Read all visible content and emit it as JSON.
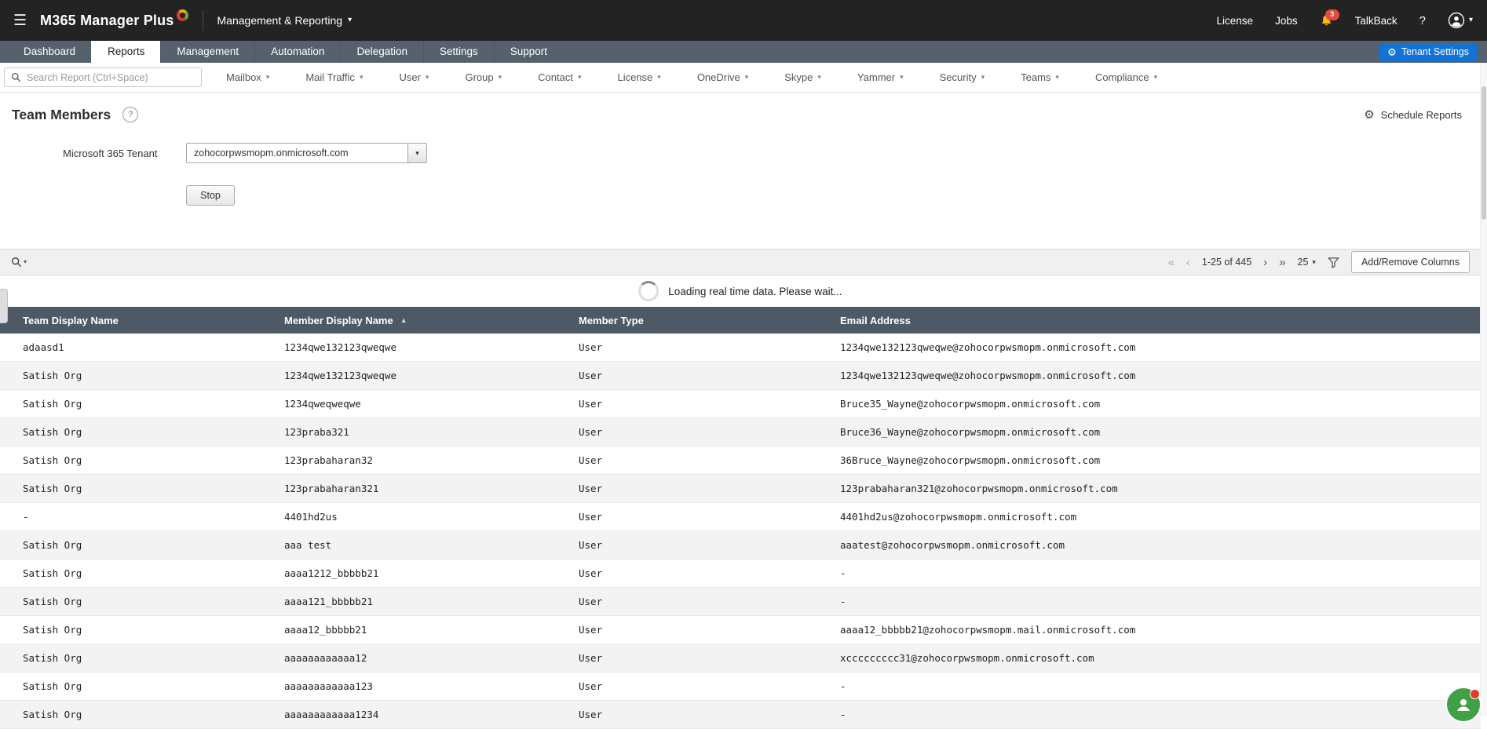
{
  "icons": {
    "hamburger": "☰",
    "caret_down": "▾",
    "sort_asc": "▲",
    "first_page": "«",
    "prev_page": "‹",
    "next_page": "›",
    "last_page": "»",
    "gear": "⚙",
    "help": "?"
  },
  "topbar": {
    "app_name": "M365 Manager Plus",
    "context_switcher": "Management & Reporting",
    "license_link": "License",
    "jobs_link": "Jobs",
    "notification_count": "3",
    "talkback_link": "TalkBack"
  },
  "nav": {
    "tabs": [
      {
        "label": "Dashboard"
      },
      {
        "label": "Reports",
        "active": true
      },
      {
        "label": "Management"
      },
      {
        "label": "Automation"
      },
      {
        "label": "Delegation"
      },
      {
        "label": "Settings"
      },
      {
        "label": "Support"
      }
    ],
    "tenant_settings_label": "Tenant Settings"
  },
  "reportnav": {
    "search_placeholder": "Search Report (Ctrl+Space)",
    "menus": [
      {
        "label": "Mailbox"
      },
      {
        "label": "Mail Traffic"
      },
      {
        "label": "User"
      },
      {
        "label": "Group"
      },
      {
        "label": "Contact"
      },
      {
        "label": "License"
      },
      {
        "label": "OneDrive"
      },
      {
        "label": "Skype"
      },
      {
        "label": "Yammer"
      },
      {
        "label": "Security"
      },
      {
        "label": "Teams"
      },
      {
        "label": "Compliance"
      }
    ]
  },
  "page": {
    "title": "Team Members",
    "schedule_reports_label": "Schedule Reports",
    "tenant_field_label": "Microsoft 365 Tenant",
    "tenant_selected_value": "zohocorpwsmopm.onmicrosoft.com",
    "stop_button_label": "Stop"
  },
  "grid_toolbar": {
    "pagination_text": "1-25 of 445",
    "page_size": "25",
    "add_remove_columns_label": "Add/Remove Columns"
  },
  "loading_message": "Loading real time data. Please wait...",
  "table": {
    "columns": [
      {
        "label": "Team Display Name"
      },
      {
        "label": "Member Display Name",
        "sort_icon": "▲"
      },
      {
        "label": "Member Type"
      },
      {
        "label": "Email Address"
      }
    ],
    "rows": [
      {
        "team": "adaasd1",
        "member": "1234qwe132123qweqwe",
        "type": "User",
        "email": "1234qwe132123qweqwe@zohocorpwsmopm.onmicrosoft.com"
      },
      {
        "team": "Satish Org",
        "member": "1234qwe132123qweqwe",
        "type": "User",
        "email": "1234qwe132123qweqwe@zohocorpwsmopm.onmicrosoft.com"
      },
      {
        "team": "Satish Org",
        "member": "1234qweqweqwe",
        "type": "User",
        "email": "Bruce35_Wayne@zohocorpwsmopm.onmicrosoft.com"
      },
      {
        "team": "Satish Org",
        "member": "123praba321",
        "type": "User",
        "email": "Bruce36_Wayne@zohocorpwsmopm.onmicrosoft.com"
      },
      {
        "team": "Satish Org",
        "member": "123prabaharan32",
        "type": "User",
        "email": "36Bruce_Wayne@zohocorpwsmopm.onmicrosoft.com"
      },
      {
        "team": "Satish Org",
        "member": "123prabaharan321",
        "type": "User",
        "email": "123prabaharan321@zohocorpwsmopm.onmicrosoft.com"
      },
      {
        "team": "-",
        "member": "4401hd2us",
        "type": "User",
        "email": "4401hd2us@zohocorpwsmopm.onmicrosoft.com"
      },
      {
        "team": "Satish Org",
        "member": "aaa test",
        "type": "User",
        "email": "aaatest@zohocorpwsmopm.onmicrosoft.com"
      },
      {
        "team": "Satish Org",
        "member": "aaaa1212_bbbbb21",
        "type": "User",
        "email": "-"
      },
      {
        "team": "Satish Org",
        "member": "aaaa121_bbbbb21",
        "type": "User",
        "email": "-"
      },
      {
        "team": "Satish Org",
        "member": "aaaa12_bbbbb21",
        "type": "User",
        "email": "aaaa12_bbbbb21@zohocorpwsmopm.mail.onmicrosoft.com"
      },
      {
        "team": "Satish Org",
        "member": "aaaaaaaaaaaa12",
        "type": "User",
        "email": "xccccccccc31@zohocorpwsmopm.onmicrosoft.com"
      },
      {
        "team": "Satish Org",
        "member": "aaaaaaaaaaaa123",
        "type": "User",
        "email": "-"
      },
      {
        "team": "Satish Org",
        "member": "aaaaaaaaaaaa1234",
        "type": "User",
        "email": "-"
      }
    ]
  }
}
